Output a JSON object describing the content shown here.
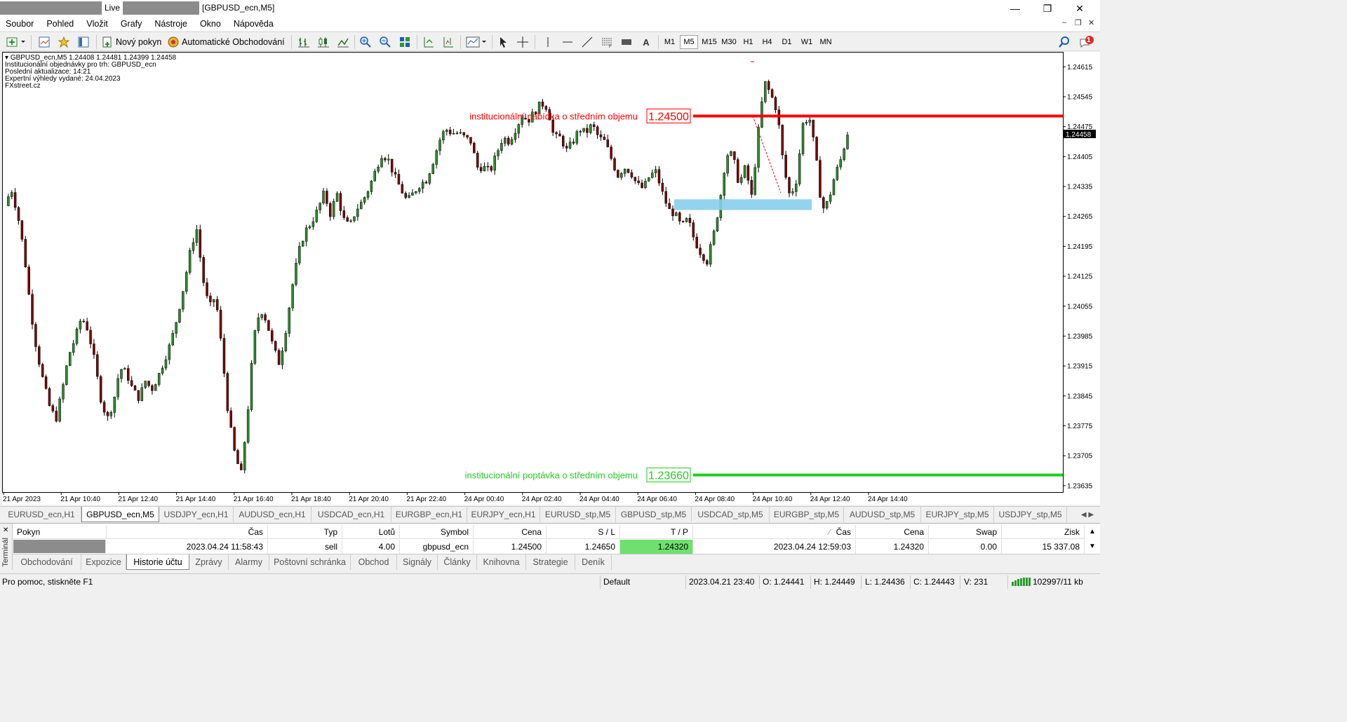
{
  "window": {
    "title_live": "Live",
    "title_symbol": "[GBPUSD_ecn,M5]",
    "minimize": "—",
    "restore": "❐",
    "close": "✕"
  },
  "menu": [
    "Soubor",
    "Pohled",
    "Vložit",
    "Grafy",
    "Nástroje",
    "Okno",
    "Nápověda"
  ],
  "mdi": {
    "minimize": "–",
    "restore": "❐",
    "close": "✕"
  },
  "toolbar": {
    "new_order": "Nový pokyn",
    "auto_trading": "Automatické Obchodování",
    "text_tool": "A",
    "timeframes": [
      "M1",
      "M5",
      "M15",
      "M30",
      "H1",
      "H4",
      "D1",
      "W1",
      "MN"
    ],
    "active_timeframe": "M5",
    "notification_count": "1"
  },
  "chart_info": {
    "line1": "GBPUSD_ecn,M5  1.24408 1.24481 1.24399 1.24458",
    "line2": "Institucionální objednávky pro trh: GBPUSD_ecn",
    "line3": "Poslední aktualizace: 14:21",
    "line4": "Expertní výhledy vydané: 24.04.2023",
    "line5": "FXstreet.cz"
  },
  "chart_data": {
    "type": "candlestick",
    "symbol": "GBPUSD_ecn",
    "timeframe": "M5",
    "ylim": [
      1.2362,
      1.2465
    ],
    "y_ticks": [
      "1.24615",
      "1.24545",
      "1.24475",
      "1.24405",
      "1.24335",
      "1.24265",
      "1.24195",
      "1.24125",
      "1.24055",
      "1.23985",
      "1.23915",
      "1.23845",
      "1.23775",
      "1.23705",
      "1.23635"
    ],
    "x_ticks": [
      "21 Apr 2023",
      "21 Apr 10:40",
      "21 Apr 12:40",
      "21 Apr 14:40",
      "21 Apr 16:40",
      "21 Apr 18:40",
      "21 Apr 20:40",
      "21 Apr 22:40",
      "24 Apr 00:40",
      "24 Apr 02:40",
      "24 Apr 04:40",
      "24 Apr 06:40",
      "24 Apr 08:40",
      "24 Apr 10:40",
      "24 Apr 12:40",
      "24 Apr 14:40"
    ],
    "current_price": "1.24458",
    "current_price_value": 1.24458,
    "levels": [
      {
        "label": "institucionální nabídka o středním objemu",
        "price": "1.24500",
        "value": 1.245,
        "color": "#ff0000"
      },
      {
        "label": "institucionální poptávka o středním objemu",
        "price": "1.23660",
        "value": 1.2366,
        "color": "#22cc22"
      }
    ],
    "zone": {
      "low": 1.2428,
      "high": 1.24305,
      "color": "#87ceeb"
    },
    "path": [
      1.2429,
      1.2433,
      1.2427,
      1.2418,
      1.2405,
      1.2395,
      1.2388,
      1.2382,
      1.2379,
      1.2386,
      1.2394,
      1.2398,
      1.2403,
      1.24,
      1.2393,
      1.2384,
      1.2379,
      1.2383,
      1.2391,
      1.239,
      1.2386,
      1.2384,
      1.2388,
      1.2386,
      1.2389,
      1.2393,
      1.2397,
      1.2403,
      1.241,
      1.2418,
      1.2424,
      1.2412,
      1.2405,
      1.2408,
      1.2395,
      1.238,
      1.2371,
      1.2366,
      1.238,
      1.2398,
      1.2405,
      1.2402,
      1.2396,
      1.2392,
      1.24,
      1.241,
      1.2418,
      1.2423,
      1.2425,
      1.2428,
      1.2432,
      1.2427,
      1.2432,
      1.2426,
      1.2424,
      1.2428,
      1.243,
      1.2433,
      1.2437,
      1.2441,
      1.244,
      1.2436,
      1.2433,
      1.243,
      1.2432,
      1.2434,
      1.2435,
      1.2439,
      1.2444,
      1.2447,
      1.2446,
      1.2446,
      1.2445,
      1.2444,
      1.2438,
      1.2438,
      1.2437,
      1.2441,
      1.2445,
      1.2444,
      1.2447,
      1.245,
      1.2449,
      1.2451,
      1.2453,
      1.2452,
      1.2445,
      1.2445,
      1.2442,
      1.2444,
      1.2447,
      1.2446,
      1.2448,
      1.2445,
      1.2444,
      1.244,
      1.2436,
      1.2438,
      1.2437,
      1.2434,
      1.2433,
      1.2436,
      1.2437,
      1.2432,
      1.2428,
      1.2427,
      1.2424,
      1.2426,
      1.2421,
      1.2418,
      1.2416,
      1.2422,
      1.243,
      1.2441,
      1.2441,
      1.2434,
      1.2438,
      1.2431,
      1.2446,
      1.2458,
      1.2455,
      1.2451,
      1.2438,
      1.2431,
      1.2435,
      1.2448,
      1.245,
      1.2441,
      1.2428,
      1.243,
      1.2436,
      1.244,
      1.2446
    ],
    "trade_line": {
      "from": 1.245,
      "to": 1.2432,
      "color": "#ff0000"
    }
  },
  "symbol_tabs": [
    "EURUSD_ecn,H1",
    "GBPUSD_ecn,M5",
    "USDJPY_ecn,H1",
    "AUDUSD_ecn,H1",
    "USDCAD_ecn,H1",
    "EURGBP_ecn,H1",
    "EURJPY_ecn,H1",
    "EURUSD_stp,M5",
    "GBPUSD_stp,M5",
    "USDCAD_stp,M5",
    "EURGBP_stp,M5",
    "AUDUSD_stp,M5",
    "EURJPY_stp,M5",
    "USDJPY_stp,M5"
  ],
  "active_symbol_tab": "GBPUSD_ecn,M5",
  "terminal": {
    "side_label": "Terminál",
    "close": "✕",
    "headers": [
      "Pokyn",
      "Čas",
      "Typ",
      "Lotů",
      "Symbol",
      "Cena",
      "S / L",
      "T / P",
      "Čas",
      "Cena",
      "Swap",
      "Zisk"
    ],
    "sort_mark": "⁄",
    "row": {
      "open_time": "2023.04.24 11:58:43",
      "type": "sell",
      "lots": "4.00",
      "symbol": "gbpusd_ecn",
      "price": "1.24500",
      "sl": "1.24650",
      "tp": "1.24320",
      "close_time": "2023.04.24 12:59:03",
      "close_price": "1.24320",
      "swap": "0.00",
      "profit": "15 337.08"
    },
    "tabs": [
      "Obchodování",
      "Expozice",
      "Historie účtu",
      "Zprávy",
      "Alarmy",
      "Poštovní schránka",
      "Obchod",
      "Signály",
      "Články",
      "Knihovna",
      "Strategie",
      "Deník"
    ],
    "active_tab": "Historie účtu"
  },
  "statusbar": {
    "help": "Pro pomoc, stiskněte F1",
    "profile": "Default",
    "datetime": "2023.04.21 23:40",
    "open": "O: 1.24441",
    "high": "H: 1.24449",
    "low": "L: 1.24436",
    "close": "C: 1.24443",
    "volume": "V: 231",
    "traffic": "102997/11 kb"
  }
}
